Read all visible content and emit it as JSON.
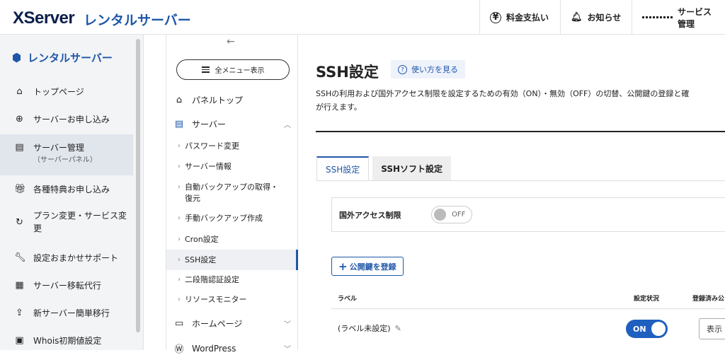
{
  "header": {
    "logo": "XServer",
    "logo_sub": "レンタルサーバー",
    "nav": [
      {
        "label": "料金支払い",
        "icon": "yen-icon"
      },
      {
        "label": "お知らせ",
        "icon": "bell-icon"
      },
      {
        "label": "サービス管理",
        "icon": "grid-icon"
      }
    ]
  },
  "left_nav": {
    "title": "レンタルサーバー",
    "items": [
      {
        "label": "トップページ",
        "icon": "home-icon"
      },
      {
        "label": "サーバーお申し込み",
        "icon": "plus-circle-icon"
      },
      {
        "label": "サーバー管理",
        "sub": "（サーバーパネル）",
        "icon": "server-icon",
        "active": true
      },
      {
        "label": "各種特典お申し込み",
        "icon": "gift-icon"
      },
      {
        "label": "プラン変更・サービス変更",
        "icon": "refresh-icon"
      },
      {
        "label": "設定おまかせサポート",
        "icon": "wrench-icon"
      },
      {
        "label": "サーバー移転代行",
        "icon": "transfer-icon"
      },
      {
        "label": "新サーバー簡単移行",
        "icon": "migrate-icon"
      },
      {
        "label": "Whois初期値設定",
        "icon": "doc-icon"
      }
    ]
  },
  "panel_nav": {
    "menu_button": "全メニュー表示",
    "panel_top": "パネルトップ",
    "server_section": "サーバー",
    "sub_items": [
      "パスワード変更",
      "サーバー情報",
      "自動バックアップの取得・復元",
      "手動バックアップ作成",
      "Cron設定",
      "SSH設定",
      "二段階認証設定",
      "リソースモニター"
    ],
    "homepage_section": "ホームページ",
    "wordpress_section": "WordPress"
  },
  "main": {
    "title": "SSH設定",
    "howto": "使い方を見る",
    "desc_line1": "SSHの利用および国外アクセス制限を設定するための有効（ON）・無効（OFF）の切替、公開鍵の登録と確",
    "desc_line2": "が行えます。",
    "tabs": [
      "SSH設定",
      "SSHソフト設定"
    ],
    "foreign_access_label": "国外アクセス制限",
    "foreign_access_state": "OFF",
    "add_key_button": "公開鍵を登録",
    "table_headers": [
      "ラベル",
      "設定状況",
      "登録済み公"
    ],
    "row": {
      "label": "(ラベル未設定)",
      "status": "ON",
      "show_button": "表示"
    }
  }
}
